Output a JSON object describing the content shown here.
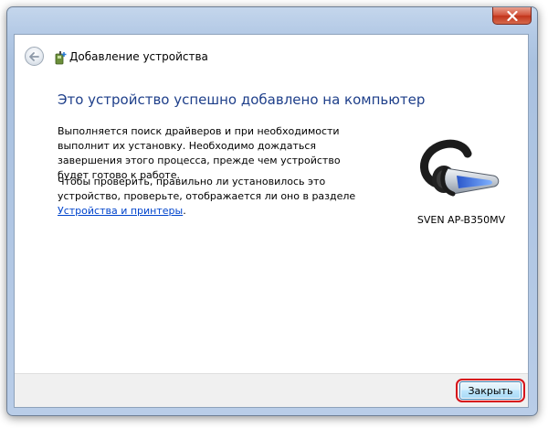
{
  "window": {
    "close_glyph": "close-x-icon"
  },
  "header": {
    "title": "Добавление устройства"
  },
  "main": {
    "heading": "Это устройство успешно добавлено на компьютер",
    "paragraph1": "Выполняется поиск драйверов и при необходимости выполнит их установку. Необходимо дождаться завершения этого процесса, прежде чем устройство будет готово к работе.",
    "paragraph2_prefix": "Чтобы проверить, правильно ли установилось это устройство, проверьте, отображается ли оно в разделе ",
    "paragraph2_link": "Устройства и принтеры",
    "paragraph2_suffix": "."
  },
  "device": {
    "name": "SVEN AP-B350MV",
    "icon": "bluetooth-headset-icon"
  },
  "footer": {
    "close_label": "Закрыть"
  },
  "colors": {
    "heading": "#1e3f8a",
    "link": "#0044cc",
    "highlight": "#d6141b",
    "close_window": "#c2341c"
  }
}
